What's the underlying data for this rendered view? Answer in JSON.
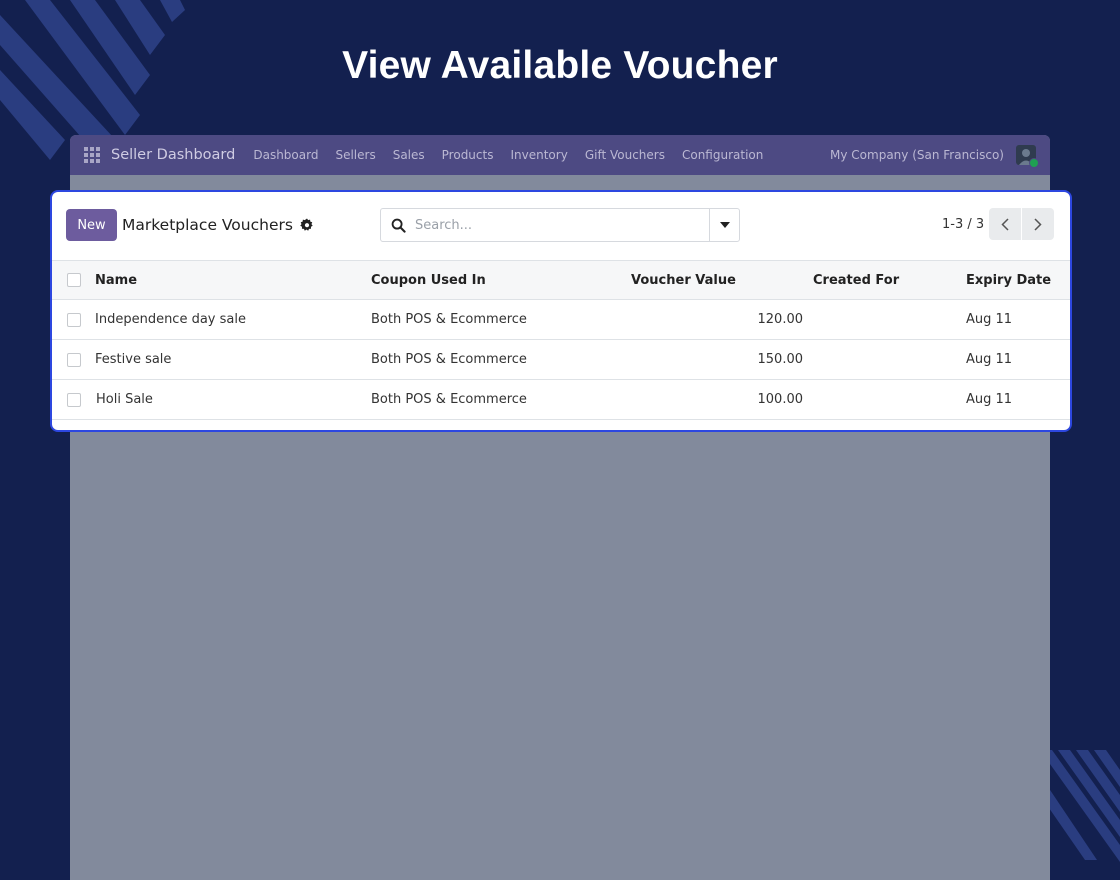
{
  "headline": "View Available Voucher",
  "app": {
    "brand": "Seller Dashboard",
    "menu": [
      "Dashboard",
      "Sellers",
      "Sales",
      "Products",
      "Inventory",
      "Gift Vouchers",
      "Configuration"
    ],
    "company": "My Company (San Francisco)"
  },
  "panel": {
    "new_label": "New",
    "title": "Marketplace Vouchers",
    "search_placeholder": "Search...",
    "pager": "1-3 / 3"
  },
  "table": {
    "columns": [
      "Name",
      "Coupon Used In",
      "Voucher Value",
      "Created For",
      "Expiry Date"
    ],
    "rows": [
      {
        "name": "Independence day sale",
        "coupon_used_in": "Both POS & Ecommerce",
        "voucher_value": "120.00",
        "created_for": "",
        "expiry_date": "Aug 11"
      },
      {
        "name": "Festive sale",
        "coupon_used_in": "Both POS & Ecommerce",
        "voucher_value": "150.00",
        "created_for": "",
        "expiry_date": "Aug 11"
      },
      {
        "name": "Holi Sale",
        "coupon_used_in": "Both POS & Ecommerce",
        "voucher_value": "100.00",
        "created_for": "",
        "expiry_date": "Aug 11"
      }
    ]
  },
  "colors": {
    "background": "#13204f",
    "accent": "#6d5c9e",
    "highlight_border": "#2d47e0"
  }
}
